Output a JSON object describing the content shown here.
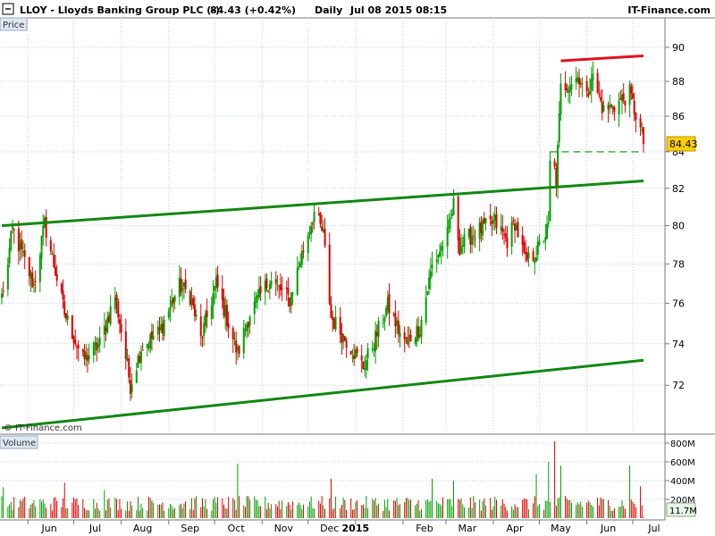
{
  "header": {
    "title": "LLOY - Lloyds Banking Group PLC (-)",
    "quote": "84.43 (+0.42%)",
    "period": "Daily",
    "datetime": "Jul 08 2015 08:15",
    "brand": "IT-Finance.com"
  },
  "price_panel_label": "Price",
  "volume_panel_label": "Volume",
  "watermark": "© IT-Finance.com",
  "colors": {
    "up": "#00a000",
    "down": "#e00000",
    "trend": "#118811",
    "resistance": "#e01020",
    "support_dashed": "#118811",
    "last_price_bg": "#ffd000",
    "panel_label_bg": "#dde8f4"
  },
  "chart_data": [
    {
      "type": "candlestick",
      "title": "LLOY - Lloyds Banking Group PLC (-)",
      "ylabel": "",
      "ylim": [
        70,
        91
      ],
      "yticks": [
        72,
        74,
        76,
        78,
        80,
        82,
        84,
        86,
        88,
        90
      ],
      "y_scale": "log",
      "grid": true,
      "x_month_labels": [
        "Jun",
        "Jul",
        "Aug",
        "Sep",
        "Oct",
        "Nov",
        "Dec",
        "2015",
        "Feb",
        "Mar",
        "Apr",
        "May",
        "Jun",
        "Jul"
      ],
      "last_price": 84.43,
      "anchors": [
        [
          "2014-05-16",
          76.5
        ],
        [
          "2014-05-22",
          79.8
        ],
        [
          "2014-06-05",
          76.9
        ],
        [
          "2014-06-12",
          80.1
        ],
        [
          "2014-06-25",
          75.5
        ],
        [
          "2014-07-07",
          73.2
        ],
        [
          "2014-07-18",
          74.0
        ],
        [
          "2014-07-28",
          76.4
        ],
        [
          "2014-08-07",
          72.0
        ],
        [
          "2014-08-14",
          73.8
        ],
        [
          "2014-08-26",
          74.6
        ],
        [
          "2014-09-08",
          76.9
        ],
        [
          "2014-09-15",
          76.4
        ],
        [
          "2014-09-22",
          74.2
        ],
        [
          "2014-10-02",
          77.0
        ],
        [
          "2014-10-16",
          73.5
        ],
        [
          "2014-10-24",
          75.5
        ],
        [
          "2014-11-06",
          77.2
        ],
        [
          "2014-11-19",
          76.2
        ],
        [
          "2014-11-28",
          78.8
        ],
        [
          "2014-12-05",
          80.7
        ],
        [
          "2014-12-11",
          79.5
        ],
        [
          "2014-12-16",
          75.3
        ],
        [
          "2015-01-06",
          72.9
        ],
        [
          "2015-01-09",
          73.4
        ],
        [
          "2015-01-14",
          74.3
        ],
        [
          "2015-01-22",
          75.9
        ],
        [
          "2015-02-02",
          74.0
        ],
        [
          "2015-02-12",
          74.8
        ],
        [
          "2015-02-20",
          77.9
        ],
        [
          "2015-03-02",
          79.5
        ],
        [
          "2015-03-06",
          81.1
        ],
        [
          "2015-03-10",
          78.9
        ],
        [
          "2015-03-19",
          79.6
        ],
        [
          "2015-04-02",
          80.2
        ],
        [
          "2015-04-10",
          79.2
        ],
        [
          "2015-04-15",
          80.2
        ],
        [
          "2015-04-22",
          78.1
        ],
        [
          "2015-04-29",
          78.6
        ],
        [
          "2015-05-07",
          79.9
        ],
        [
          "2015-05-08",
          83.3
        ],
        [
          "2015-05-11",
          83.0
        ],
        [
          "2015-05-12",
          82.3
        ],
        [
          "2015-05-15",
          87.6
        ],
        [
          "2015-05-27",
          88.3
        ],
        [
          "2015-06-01",
          87.0
        ],
        [
          "2015-06-04",
          88.4
        ],
        [
          "2015-06-12",
          86.3
        ],
        [
          "2015-06-22",
          86.8
        ],
        [
          "2015-06-29",
          87.3
        ],
        [
          "2015-07-06",
          85.2
        ],
        [
          "2015-07-08",
          84.43
        ]
      ],
      "trendlines": [
        {
          "name": "upper channel",
          "style": "solid",
          "color": "#118811",
          "points": [
            [
              "2014-05-15",
              80.0
            ],
            [
              "2015-07-08",
              82.4
            ]
          ]
        },
        {
          "name": "lower channel",
          "style": "solid",
          "color": "#118811",
          "points": [
            [
              "2014-05-15",
              70.0
            ],
            [
              "2015-07-08",
              73.2
            ]
          ]
        },
        {
          "name": "resistance",
          "style": "solid",
          "color": "#e01020",
          "points": [
            [
              "2015-05-15",
              89.2
            ],
            [
              "2015-07-08",
              89.5
            ]
          ]
        },
        {
          "name": "support",
          "style": "dashed",
          "color": "#118811",
          "points": [
            [
              "2015-05-08",
              84.0
            ],
            [
              "2015-07-08",
              84.0
            ]
          ]
        }
      ]
    },
    {
      "type": "bar",
      "title": "Volume",
      "ylim": [
        0,
        850
      ],
      "yticks": [
        200,
        400,
        600,
        800
      ],
      "ytick_labels": [
        "200M",
        "400M",
        "600M",
        "800M"
      ],
      "last_value_label": "11.7M",
      "typical_volume_m": 170,
      "spikes": [
        [
          "2014-05-16",
          330
        ],
        [
          "2014-06-25",
          380
        ],
        [
          "2014-07-21",
          300
        ],
        [
          "2014-10-16",
          580
        ],
        [
          "2014-12-16",
          420
        ],
        [
          "2015-02-20",
          420
        ],
        [
          "2015-03-06",
          400
        ],
        [
          "2015-04-29",
          470
        ],
        [
          "2015-05-07",
          600
        ],
        [
          "2015-05-11",
          820
        ],
        [
          "2015-05-15",
          560
        ],
        [
          "2015-06-29",
          560
        ],
        [
          "2015-07-06",
          340
        ]
      ]
    }
  ]
}
